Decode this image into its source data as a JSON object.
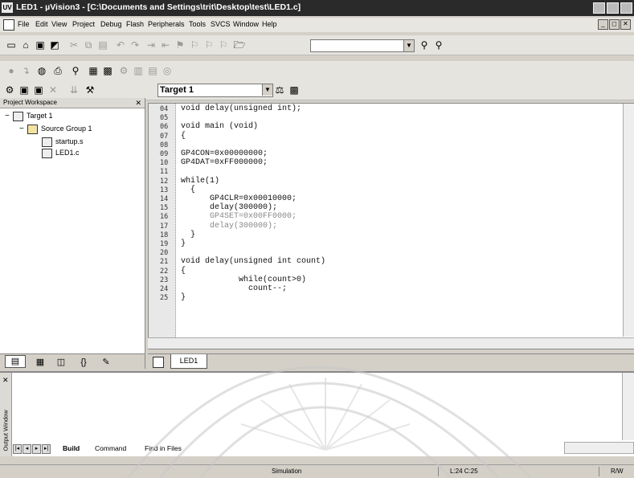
{
  "window": {
    "app_icon": "UV",
    "title": "LED1 - µVision3 - [C:\\Documents and Settings\\trit\\Desktop\\test\\LED1.c]"
  },
  "menu": [
    "File",
    "Edit",
    "View",
    "Project",
    "Debug",
    "Flash",
    "Peripherals",
    "Tools",
    "SVCS",
    "Window",
    "Help"
  ],
  "toolbar": {
    "target_label": "Target 1"
  },
  "workspace": {
    "title": "Project Workspace",
    "tree": [
      {
        "label": "Target 1",
        "level": 0,
        "expander": "−"
      },
      {
        "label": "Source Group 1",
        "level": 1,
        "expander": "−"
      },
      {
        "label": "startup.s",
        "level": 2,
        "expander": ""
      },
      {
        "label": "LED1.c",
        "level": 2,
        "expander": ""
      }
    ]
  },
  "editor": {
    "tab_label": "LED1",
    "lines": [
      {
        "n": "04",
        "text": "void delay(unsigned int);"
      },
      {
        "n": "05",
        "text": ""
      },
      {
        "n": "06",
        "text": "void main (void)"
      },
      {
        "n": "07",
        "text": "{"
      },
      {
        "n": "08",
        "text": ""
      },
      {
        "n": "09",
        "text": "GP4CON=0x00000000;"
      },
      {
        "n": "10",
        "text": "GP4DAT=0xFF000000;"
      },
      {
        "n": "11",
        "text": ""
      },
      {
        "n": "12",
        "text": "while(1)"
      },
      {
        "n": "13",
        "text": "  {"
      },
      {
        "n": "14",
        "text": "      GP4CLR=0x00010000;"
      },
      {
        "n": "15",
        "text": "      delay(300000);"
      },
      {
        "n": "16",
        "text": "      GP4SET=0x00FF0000;"
      },
      {
        "n": "17",
        "text": "      delay(300000);"
      },
      {
        "n": "18",
        "text": "  }"
      },
      {
        "n": "19",
        "text": "}"
      },
      {
        "n": "20",
        "text": ""
      },
      {
        "n": "21",
        "text": "void delay(unsigned int count)"
      },
      {
        "n": "22",
        "text": "{"
      },
      {
        "n": "23",
        "text": "            while(count>0)"
      },
      {
        "n": "24",
        "text": "              count--;"
      },
      {
        "n": "25",
        "text": "}"
      }
    ]
  },
  "output": {
    "side_label": "Output Window",
    "tabs": [
      "Build",
      "Command",
      "Find in Files"
    ],
    "active_tab": "Build"
  },
  "status": {
    "mode": "Simulation",
    "position": "L:24 C:25",
    "rw": "R/W"
  }
}
